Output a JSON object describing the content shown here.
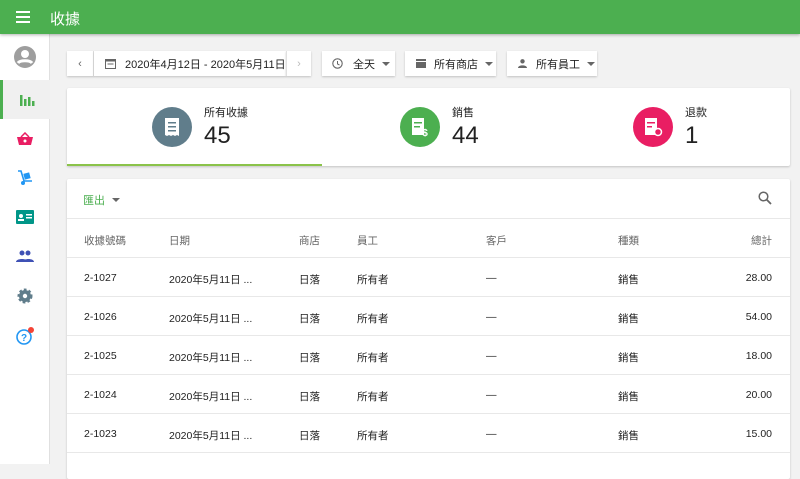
{
  "app": {
    "title": "收據"
  },
  "sidebar": {
    "items": [
      "account",
      "reports",
      "items",
      "inventory",
      "customers",
      "employees",
      "settings",
      "help"
    ]
  },
  "filters": {
    "date_range": "2020年4月12日 - 2020年5月11日",
    "time": "全天",
    "store": "所有商店",
    "employee": "所有員工"
  },
  "summary": [
    {
      "label": "所有收據",
      "value": "45",
      "color": "#607D8B"
    },
    {
      "label": "銷售",
      "value": "44",
      "color": "#4CAF50"
    },
    {
      "label": "退款",
      "value": "1",
      "color": "#E91E63"
    }
  ],
  "table": {
    "export_label": "匯出",
    "headers": [
      "收據號碼",
      "日期",
      "商店",
      "員工",
      "客戶",
      "種類",
      "總計"
    ],
    "rows": [
      [
        "2-1027",
        "2020年5月11日 ...",
        "日落",
        "所有者",
        "—",
        "銷售",
        "28.00"
      ],
      [
        "2-1026",
        "2020年5月11日 ...",
        "日落",
        "所有者",
        "—",
        "銷售",
        "54.00"
      ],
      [
        "2-1025",
        "2020年5月11日 ...",
        "日落",
        "所有者",
        "—",
        "銷售",
        "18.00"
      ],
      [
        "2-1024",
        "2020年5月11日 ...",
        "日落",
        "所有者",
        "—",
        "銷售",
        "20.00"
      ],
      [
        "2-1023",
        "2020年5月11日 ...",
        "日落",
        "所有者",
        "—",
        "銷售",
        "15.00"
      ]
    ]
  },
  "colors": {
    "primary": "#4CAF50",
    "accent": "#E91E63"
  }
}
